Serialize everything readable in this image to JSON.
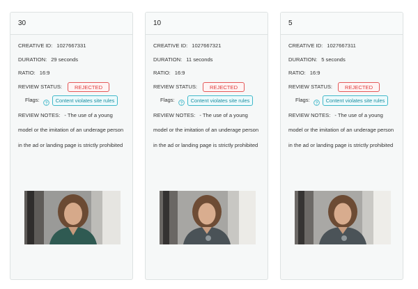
{
  "cards": [
    {
      "header": "30",
      "creative_id_label": "CREATIVE ID:",
      "creative_id": "1027667331",
      "duration_label": "DURATION:",
      "duration": "29 seconds",
      "ratio_label": "RATIO:",
      "ratio": "16:9",
      "review_status_label": "REVIEW STATUS:",
      "review_status": "REJECTED",
      "flags_label": "Flags:",
      "flag": "Content violates site rules",
      "review_notes_label": "REVIEW NOTES:",
      "review_notes": "- The use of a young model or the imitation of an underage person in the ad or landing page is strictly prohibited",
      "help_icon": "question-circle-icon",
      "thumbnail": "video-thumbnail-woman-green-jacket"
    },
    {
      "header": "10",
      "creative_id_label": "CREATIVE ID:",
      "creative_id": "1027667321",
      "duration_label": "DURATION:",
      "duration": "11 seconds",
      "ratio_label": "RATIO:",
      "ratio": "16:9",
      "review_status_label": "REVIEW STATUS:",
      "review_status": "REJECTED",
      "flags_label": "Flags:",
      "flag": "Content violates site rules",
      "review_notes_label": "REVIEW NOTES:",
      "review_notes": "- The use of a young model or the imitation of an underage person in the ad or landing page is strictly prohibited",
      "help_icon": "question-circle-icon",
      "thumbnail": "video-thumbnail-woman-grey-tshirt"
    },
    {
      "header": "5",
      "creative_id_label": "CREATIVE ID:",
      "creative_id": "1027667311",
      "duration_label": "DURATION:",
      "duration": "5 seconds",
      "ratio_label": "RATIO:",
      "ratio": "16:9",
      "review_status_label": "REVIEW STATUS:",
      "review_status": "REJECTED",
      "flags_label": "Flags:",
      "flag": "Content violates site rules",
      "review_notes_label": "REVIEW NOTES:",
      "review_notes": "- The use of a young model or the imitation of an underage person in the ad or landing page is strictly prohibited",
      "help_icon": "question-circle-icon",
      "thumbnail": "video-thumbnail-woman-grey-tshirt"
    }
  ],
  "colors": {
    "rejected": "#e03d3d",
    "flag": "#1c8ea0",
    "card_bg": "#f6f8f8"
  }
}
